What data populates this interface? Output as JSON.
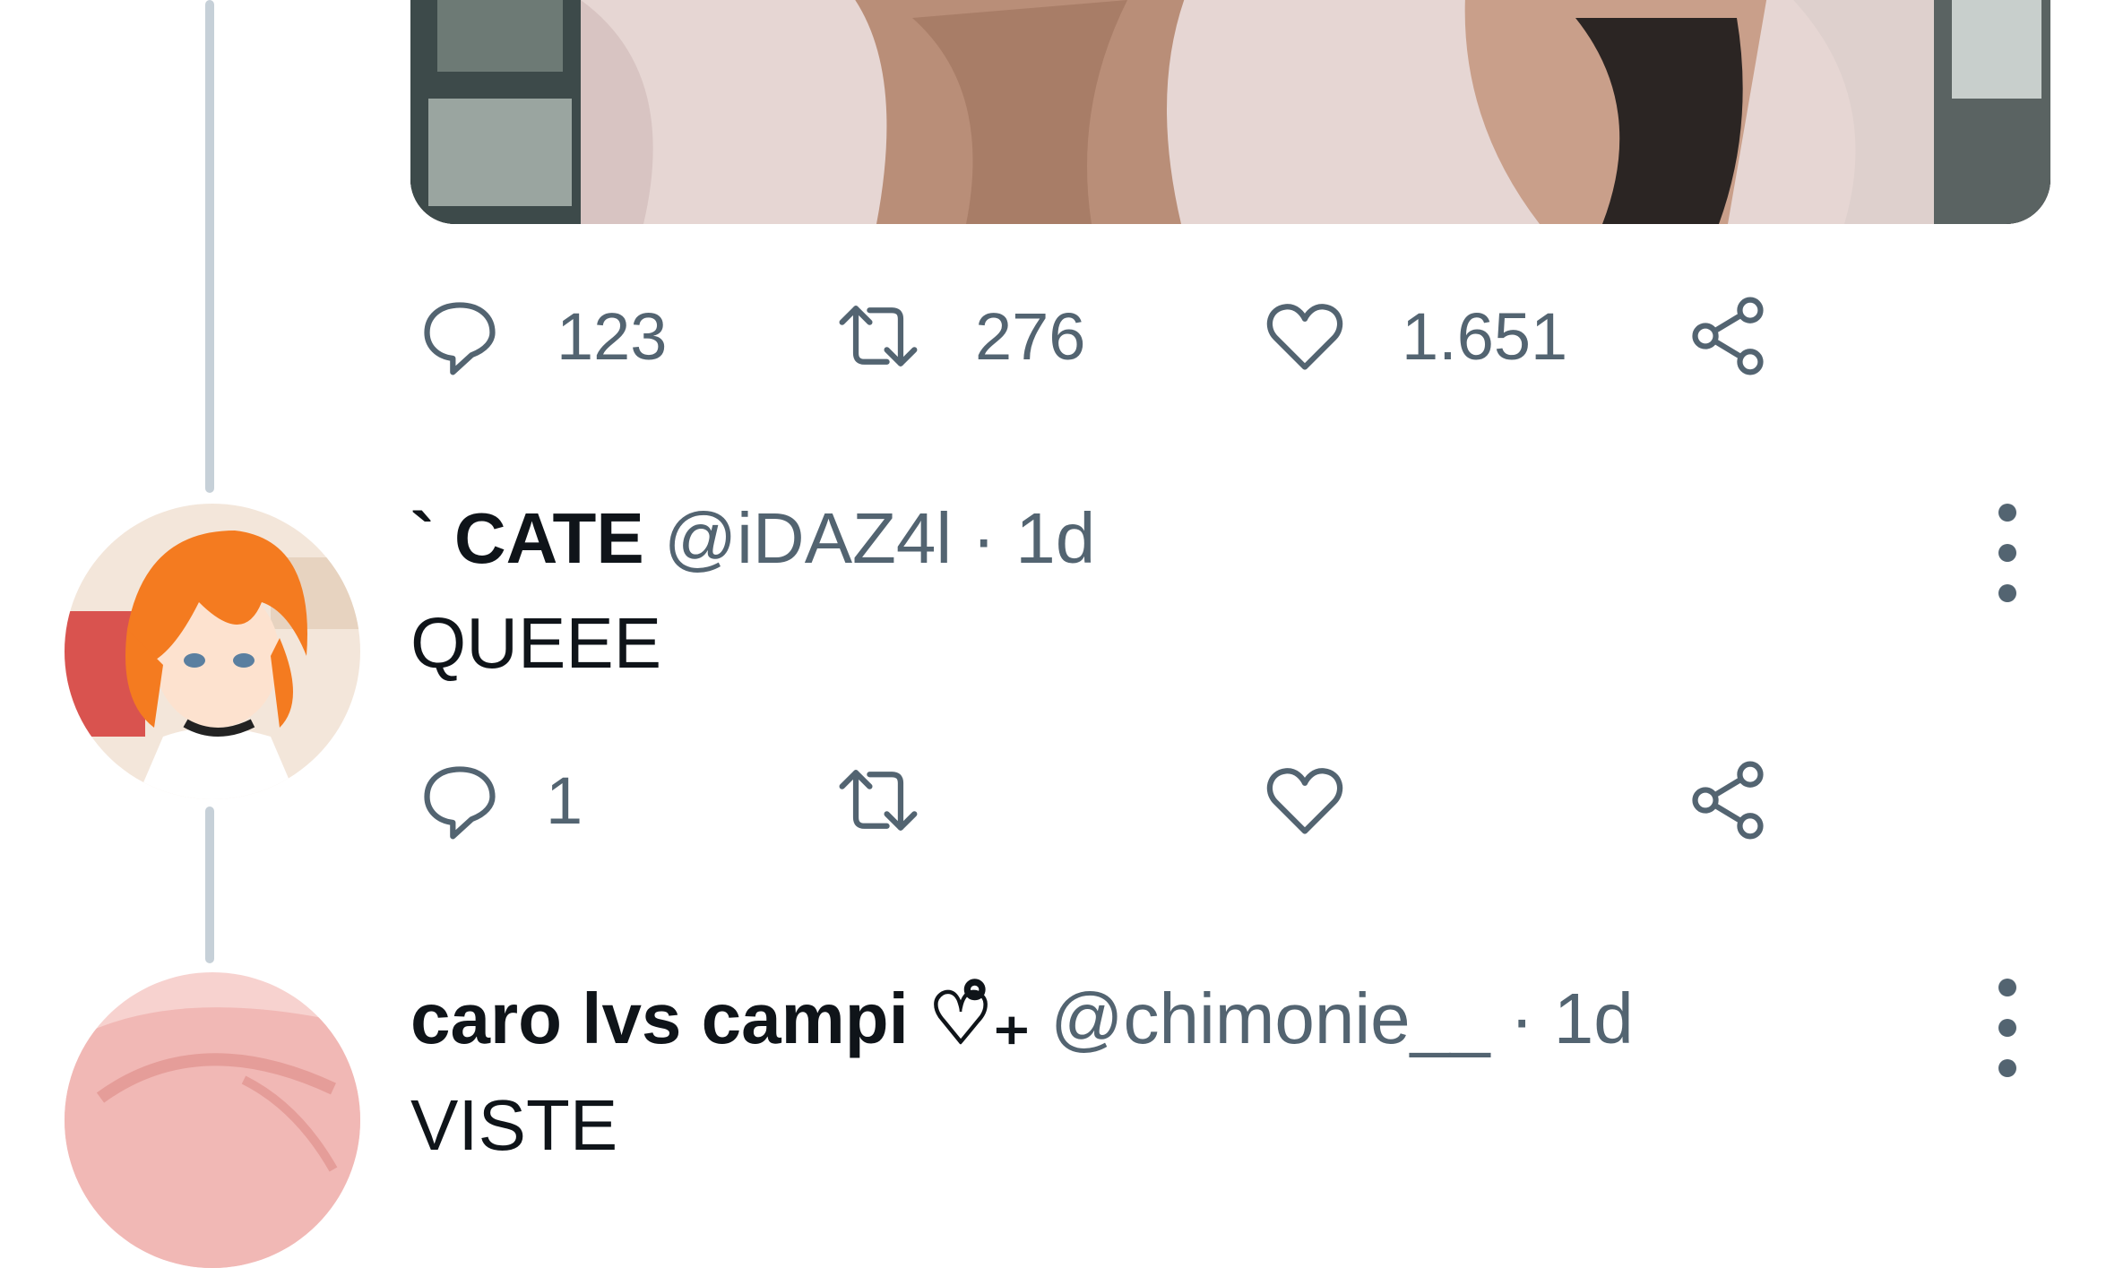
{
  "first_tweet": {
    "actions": {
      "replies": "123",
      "retweets": "276",
      "likes": "1.651"
    }
  },
  "reply1": {
    "name": "` CATE",
    "handle": "@iDAZ4l",
    "time": "· 1d",
    "text": "QUEEE",
    "actions": {
      "replies": "1",
      "retweets": "",
      "likes": ""
    }
  },
  "reply2": {
    "name": "caro lvs campi ♡̊₊",
    "handle": "@chimonie__",
    "time": "· 1d",
    "text": "VISTE"
  },
  "icons": {
    "reply": "speech-bubble-icon",
    "retweet": "retweet-icon",
    "like": "heart-icon",
    "share": "share-icon",
    "more": "vertical-ellipsis-icon"
  },
  "colors": {
    "icon_gray": "#536471",
    "text": "#0f1419",
    "thread_line": "#c6d0d8"
  }
}
